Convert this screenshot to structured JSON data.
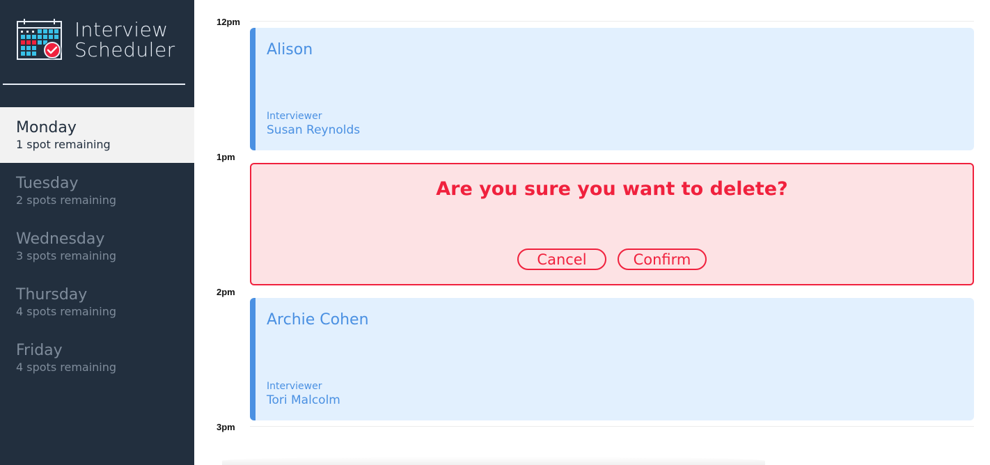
{
  "app": {
    "title_line1": "Interview",
    "title_line2": "Scheduler",
    "logo_icon": "calendar-check-icon"
  },
  "sidebar": {
    "days": [
      {
        "name": "Monday",
        "spots": "1 spot remaining",
        "selected": true
      },
      {
        "name": "Tuesday",
        "spots": "2 spots remaining",
        "selected": false
      },
      {
        "name": "Wednesday",
        "spots": "3 spots remaining",
        "selected": false
      },
      {
        "name": "Thursday",
        "spots": "4 spots remaining",
        "selected": false
      },
      {
        "name": "Friday",
        "spots": "4 spots remaining",
        "selected": false
      }
    ]
  },
  "schedule": {
    "times": [
      "12pm",
      "1pm",
      "2pm",
      "3pm"
    ],
    "appointments": [
      {
        "student": "Alison",
        "interviewer_label": "Interviewer",
        "interviewer": "Susan Reynolds"
      },
      {
        "confirm_message": "Are you sure you want to delete?",
        "cancel_label": "Cancel",
        "confirm_label": "Confirm"
      },
      {
        "student": "Archie Cohen",
        "interviewer_label": "Interviewer",
        "interviewer": "Tori Malcolm"
      }
    ]
  },
  "colors": {
    "sidebar_bg": "#222f3e",
    "selected_bg": "#f2f2f2",
    "appointment_bg": "#e2f0fe",
    "appointment_accent": "#4a90e2",
    "danger": "#f0213d",
    "danger_bg": "#fde2e4"
  }
}
